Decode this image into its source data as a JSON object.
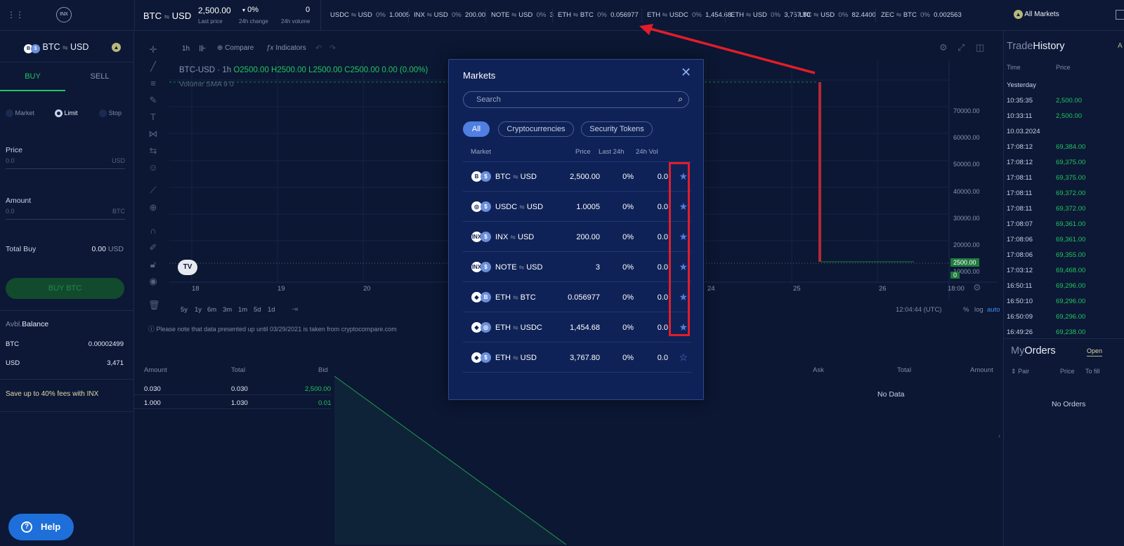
{
  "topbar": {
    "pair_base": "BTC",
    "pair_quote": "USD",
    "last_price": "2,500.00",
    "last_price_label": "Last price",
    "change": "0%",
    "change_label": "24h change",
    "volume": "0",
    "volume_label": "24h volume",
    "logo": "INX",
    "all_markets": "All Markets",
    "tickers": [
      {
        "base": "USDC",
        "quote": "USD",
        "pct": "0%",
        "price": "1.0005"
      },
      {
        "base": "INX",
        "quote": "USD",
        "pct": "0%",
        "price": "200.00"
      },
      {
        "base": "NOTE",
        "quote": "USD",
        "pct": "0%",
        "price": "3"
      },
      {
        "base": "ETH",
        "quote": "BTC",
        "pct": "0%",
        "price": "0.056977"
      },
      {
        "base": "ETH",
        "quote": "USDC",
        "pct": "0%",
        "price": "1,454.68"
      },
      {
        "base": "ETH",
        "quote": "USD",
        "pct": "0%",
        "price": "3,767.80"
      },
      {
        "base": "LTC",
        "quote": "USD",
        "pct": "0%",
        "price": "82.4400"
      },
      {
        "base": "ZEC",
        "quote": "BTC",
        "pct": "0%",
        "price": "0.002563"
      }
    ]
  },
  "left": {
    "pair_base": "BTC",
    "pair_quote": "USD",
    "buy_tab": "BUY",
    "sell_tab": "SELL",
    "order_types": [
      "Market",
      "Limit",
      "Stop"
    ],
    "price_label": "Price",
    "price_value": "0.0",
    "price_unit": "USD",
    "amount_label": "Amount",
    "amount_value": "0.0",
    "amount_unit": "BTC",
    "total_label": "Total Buy",
    "total_value": "0.00",
    "total_unit": "USD",
    "buy_button": "BUY BTC",
    "balance_label_a": "Avbl.",
    "balance_label_b": "Balance",
    "balances": [
      {
        "asset": "BTC",
        "value": "0.00002499"
      },
      {
        "asset": "USD",
        "value": "3,471"
      }
    ],
    "promo": "Save up to 40% fees with INX",
    "help": "Help"
  },
  "chart": {
    "interval": "1h",
    "compare": "Compare",
    "indicators": "Indicators",
    "legend_symbol": "BTC-USD · 1h",
    "ohlc": "O2500.00 H2500.00 L2500.00 C2500.00 0.00 (0.00%)",
    "volume_legend": "Volume SMA 9",
    "volume_value": "0",
    "y_ticks": [
      "70000.00",
      "60000.00",
      "50000.00",
      "40000.00",
      "30000.00",
      "20000.00",
      "10000.00"
    ],
    "price_tag": "2500.00",
    "zero_tag": "0",
    "x_ticks": [
      "18",
      "19",
      "20",
      "24",
      "25",
      "26",
      "18:00"
    ],
    "ranges": [
      "5y",
      "1y",
      "6m",
      "3m",
      "1m",
      "5d",
      "1d"
    ],
    "clock": "12:04:44 (UTC)",
    "scale_opts": [
      "%",
      "log",
      "auto"
    ],
    "note": "Please note that data presented up until 03/29/2021 is taken from cryptocompare.com"
  },
  "orderbook": {
    "bid_headers": [
      "Amount",
      "Total",
      "Bid"
    ],
    "ask_headers": [
      "Ask",
      "Total",
      "Amount"
    ],
    "bids": [
      {
        "amount": "0.030",
        "total": "0.030",
        "price": "2,500.00"
      },
      {
        "amount": "1.000",
        "total": "1.030",
        "price": "0.01"
      }
    ],
    "asks_empty": "No Data"
  },
  "right": {
    "title_a": "Trade",
    "title_b": "History",
    "tab_partial": "A",
    "col_time": "Time",
    "col_price": "Price",
    "groups": [
      {
        "label": "Yesterday",
        "rows": [
          {
            "time": "10:35:35",
            "price": "2,500.00"
          },
          {
            "time": "10:33:11",
            "price": "2,500.00"
          }
        ]
      },
      {
        "label": "10.03.2024",
        "rows": [
          {
            "time": "17:08:12",
            "price": "69,384.00"
          },
          {
            "time": "17:08:12",
            "price": "69,375.00"
          },
          {
            "time": "17:08:11",
            "price": "69,375.00"
          },
          {
            "time": "17:08:11",
            "price": "69,372.00"
          },
          {
            "time": "17:08:11",
            "price": "69,372.00"
          },
          {
            "time": "17:08:07",
            "price": "69,361.00"
          },
          {
            "time": "17:08:06",
            "price": "69,361.00"
          },
          {
            "time": "17:08:06",
            "price": "69,355.00"
          },
          {
            "time": "17:03:12",
            "price": "69,468.00"
          },
          {
            "time": "16:50:11",
            "price": "69,296.00"
          },
          {
            "time": "16:50:10",
            "price": "69,296.00"
          },
          {
            "time": "16:50:09",
            "price": "69,296.00"
          },
          {
            "time": "16:49:26",
            "price": "69,238.00"
          }
        ]
      }
    ],
    "orders_title_a": "My",
    "orders_title_b": "Orders",
    "orders_tab": "Open",
    "orders_col_pair": "Pair",
    "orders_col_price": "Price",
    "orders_col_fill": "To fill",
    "orders_empty": "No Orders"
  },
  "modal": {
    "title": "Markets",
    "search_placeholder": "Search",
    "filters": [
      "All",
      "Cryptocurrencies",
      "Security Tokens"
    ],
    "headers": {
      "market": "Market",
      "price": "Price",
      "last": "Last 24h",
      "vol": "24h Vol"
    },
    "rows": [
      {
        "base": "BTC",
        "quote": "USD",
        "price": "2,500.00",
        "change": "0%",
        "vol": "0.0",
        "fav": true,
        "icon_a": "B",
        "icon_b": "$"
      },
      {
        "base": "USDC",
        "quote": "USD",
        "price": "1.0005",
        "change": "0%",
        "vol": "0.0",
        "fav": true,
        "icon_a": "◎",
        "icon_b": "$"
      },
      {
        "base": "INX",
        "quote": "USD",
        "price": "200.00",
        "change": "0%",
        "vol": "0.0",
        "fav": true,
        "icon_a": "INX",
        "icon_b": "$"
      },
      {
        "base": "NOTE",
        "quote": "USD",
        "price": "3",
        "change": "0%",
        "vol": "0.0",
        "fav": true,
        "icon_a": "INX",
        "icon_b": "$"
      },
      {
        "base": "ETH",
        "quote": "BTC",
        "price": "0.056977",
        "change": "0%",
        "vol": "0.0",
        "fav": true,
        "icon_a": "◆",
        "icon_b": "B"
      },
      {
        "base": "ETH",
        "quote": "USDC",
        "price": "1,454.68",
        "change": "0%",
        "vol": "0.0",
        "fav": true,
        "icon_a": "◆",
        "icon_b": "◎"
      },
      {
        "base": "ETH",
        "quote": "USD",
        "price": "3,767.80",
        "change": "0%",
        "vol": "0.0",
        "fav": false,
        "icon_a": "◆",
        "icon_b": "$"
      }
    ]
  },
  "colors": {
    "accent": "#22c55e",
    "star": "#4f7fe0",
    "highlight": "#e11d2a",
    "modal_bg": "#0f2257",
    "page_bg": "#0b1733"
  }
}
